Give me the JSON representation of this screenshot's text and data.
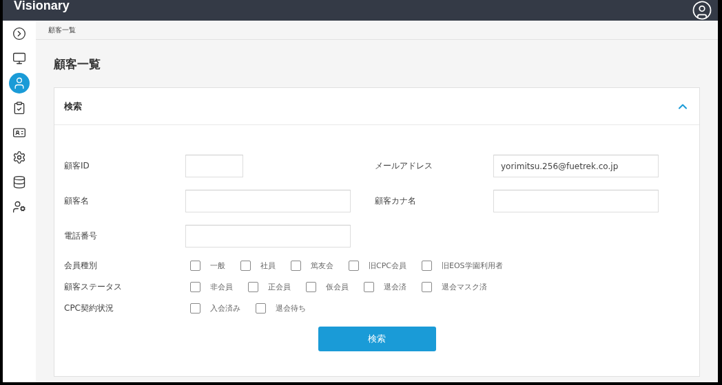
{
  "header": {
    "brand": "Visionary"
  },
  "sidebar": {
    "items": [
      {
        "kind": "expand",
        "selected": false
      },
      {
        "kind": "monitor",
        "selected": false
      },
      {
        "kind": "user",
        "selected": true
      },
      {
        "kind": "clipboard",
        "selected": false
      },
      {
        "kind": "card",
        "selected": false
      },
      {
        "kind": "settings",
        "selected": false
      },
      {
        "kind": "database",
        "selected": false
      },
      {
        "kind": "usergear",
        "selected": false
      }
    ]
  },
  "breadcrumb": "顧客一覧",
  "title": "顧客一覧",
  "search_panel": {
    "title": "検索",
    "expanded": true,
    "fields": [
      {
        "label": "顧客ID",
        "kind": "short"
      },
      {
        "label": "メールアドレス",
        "value": "yorimitsu.256@fuetrek.co.jp",
        "kind": "long"
      },
      {
        "label": "顧客名",
        "kind": "long"
      },
      {
        "label": "顧客カナ名",
        "kind": "long"
      },
      {
        "label": "電話番号",
        "kind": "long"
      }
    ],
    "checkbox_groups": [
      {
        "label": "会員種別",
        "options": [
          {
            "label": "一般",
            "checked": false
          },
          {
            "label": "社員",
            "checked": false
          },
          {
            "label": "篤友会",
            "checked": false
          },
          {
            "label": "旧CPC会員",
            "checked": false
          },
          {
            "label": "旧EOS学園利用者",
            "checked": false
          }
        ]
      },
      {
        "label": "顧客ステータス",
        "options": [
          {
            "label": "非会員",
            "checked": false
          },
          {
            "label": "正会員",
            "checked": false
          },
          {
            "label": "仮会員",
            "checked": false
          },
          {
            "label": "退会済",
            "checked": false
          },
          {
            "label": "退会マスク済",
            "checked": false
          }
        ]
      },
      {
        "label": "CPC契約状況",
        "options": [
          {
            "label": "入会済み",
            "checked": false
          },
          {
            "label": "退会待ち",
            "checked": false
          }
        ]
      }
    ],
    "button": "検索"
  }
}
